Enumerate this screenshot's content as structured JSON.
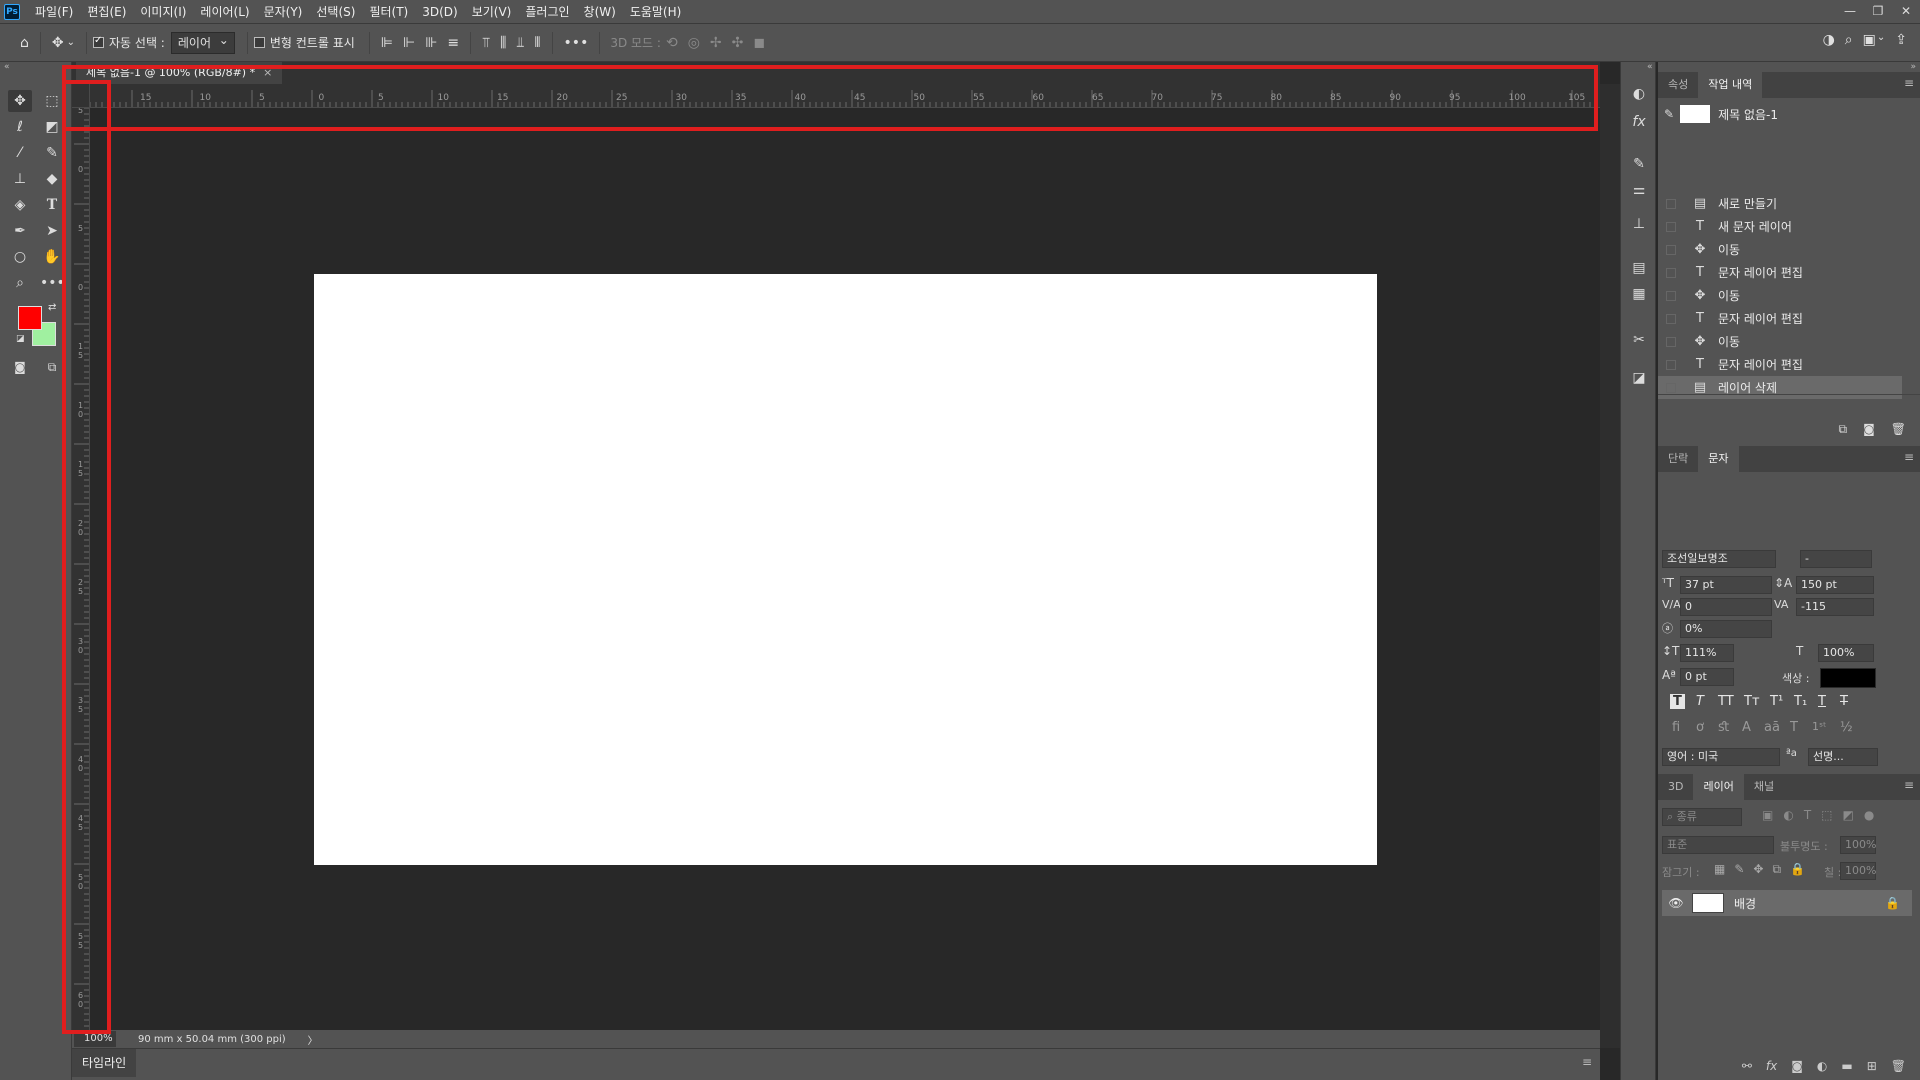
{
  "menu": [
    "파일(F)",
    "편집(E)",
    "이미지(I)",
    "레이어(L)",
    "문자(Y)",
    "선택(S)",
    "필터(T)",
    "3D(D)",
    "보기(V)",
    "플러그인",
    "창(W)",
    "도움말(H)"
  ],
  "app_logo": "Ps",
  "options": {
    "auto_select_label": "자동 선택 :",
    "auto_select_value": "레이어",
    "transform_label": "변형 컨트롤 표시",
    "mode_3d_label": "3D 모드 :"
  },
  "document": {
    "tab_title": "제목 없음-1 @ 100% (RGB/8#) *",
    "zoom": "100%",
    "info": "90 mm x 50.04 mm (300 ppi)",
    "status_arrow": "〉"
  },
  "ruler": {
    "h_labels": [
      "15",
      "10",
      "5",
      "0",
      "5",
      "10",
      "15",
      "20",
      "25",
      "30",
      "35",
      "40",
      "45",
      "50",
      "55",
      "60",
      "65",
      "70",
      "75",
      "80",
      "85",
      "90",
      "95",
      "100",
      "105"
    ],
    "v_labels": [
      "5",
      "0",
      "5",
      "0",
      "1 5",
      "1 0",
      "1 5",
      "2 0",
      "2 5",
      "3 0",
      "3 5",
      "4 0",
      "4 5",
      "5 0",
      "5 5",
      "6 0"
    ]
  },
  "colors": {
    "foreground": "#ff0000",
    "background": "#a0f0a0",
    "highlight": "#e01e1e",
    "text_color": "#000000"
  },
  "timeline_label": "타임라인",
  "history_panel": {
    "tabs": [
      "속성",
      "작업 내역"
    ],
    "snapshot_title": "제목 없음-1",
    "items": [
      {
        "icon": "document-icon",
        "glyph": "▤",
        "label": "새로 만들기"
      },
      {
        "icon": "type-icon",
        "glyph": "T",
        "label": "새 문자 레이어"
      },
      {
        "icon": "move-icon",
        "glyph": "✥",
        "label": "이동"
      },
      {
        "icon": "type-icon",
        "glyph": "T",
        "label": "문자 레이어 편집"
      },
      {
        "icon": "move-icon",
        "glyph": "✥",
        "label": "이동"
      },
      {
        "icon": "type-icon",
        "glyph": "T",
        "label": "문자 레이어 편집"
      },
      {
        "icon": "move-icon",
        "glyph": "✥",
        "label": "이동"
      },
      {
        "icon": "type-icon",
        "glyph": "T",
        "label": "문자 레이어 편집"
      },
      {
        "icon": "document-icon",
        "glyph": "▤",
        "label": "레이어 삭제"
      }
    ]
  },
  "character_panel": {
    "tabs": [
      "단락",
      "문자"
    ],
    "font_family": "조선일보명조",
    "font_style": "-",
    "font_size": "37 pt",
    "leading": "150 pt",
    "kerning": "0",
    "tracking": "-115",
    "tsume": "0%",
    "vertical_scale": "111%",
    "horizontal_scale": "100%",
    "baseline_shift": "0 pt",
    "color_label": "색상 :",
    "language": "영어 : 미국",
    "antialias": "선명..."
  },
  "layers_panel": {
    "tabs": [
      "3D",
      "레이어",
      "채널"
    ],
    "filter_placeholder": "종류",
    "blend_mode": "표준",
    "opacity_label": "불투명도 :",
    "opacity_value": "100%",
    "lock_label": "잠그기 :",
    "fill_label": "칠 :",
    "fill_value": "100%",
    "layer_name": "배경"
  }
}
